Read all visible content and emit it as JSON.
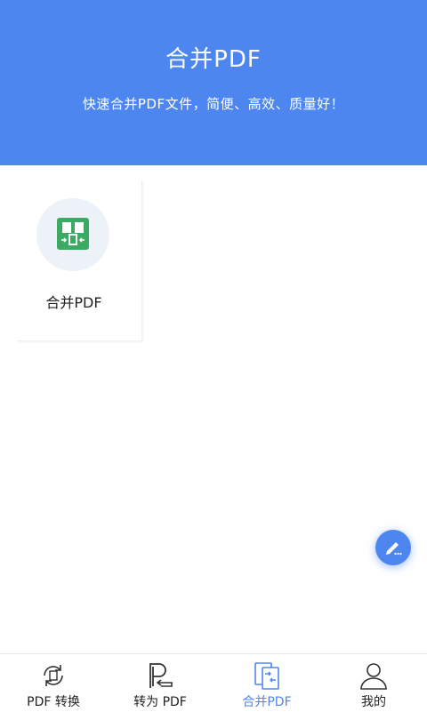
{
  "header": {
    "title": "合并PDF",
    "subtitle": "快速合并PDF文件，简便、高效、质量好！"
  },
  "tools": [
    {
      "label": "合并PDF",
      "icon": "merge-pdf-icon"
    }
  ],
  "fab": {
    "icon": "edit-icon"
  },
  "tabs": [
    {
      "label": "PDF 转换",
      "icon": "convert-icon",
      "active": false
    },
    {
      "label": "转为 PDF",
      "icon": "to-pdf-icon",
      "active": false
    },
    {
      "label": "合并PDF",
      "icon": "merge-icon",
      "active": true
    },
    {
      "label": "我的",
      "icon": "user-icon",
      "active": false
    }
  ],
  "colors": {
    "primary": "#4e86f0",
    "merge_icon_green": "#3daa64",
    "icon_circle_bg": "#edf1f8"
  }
}
